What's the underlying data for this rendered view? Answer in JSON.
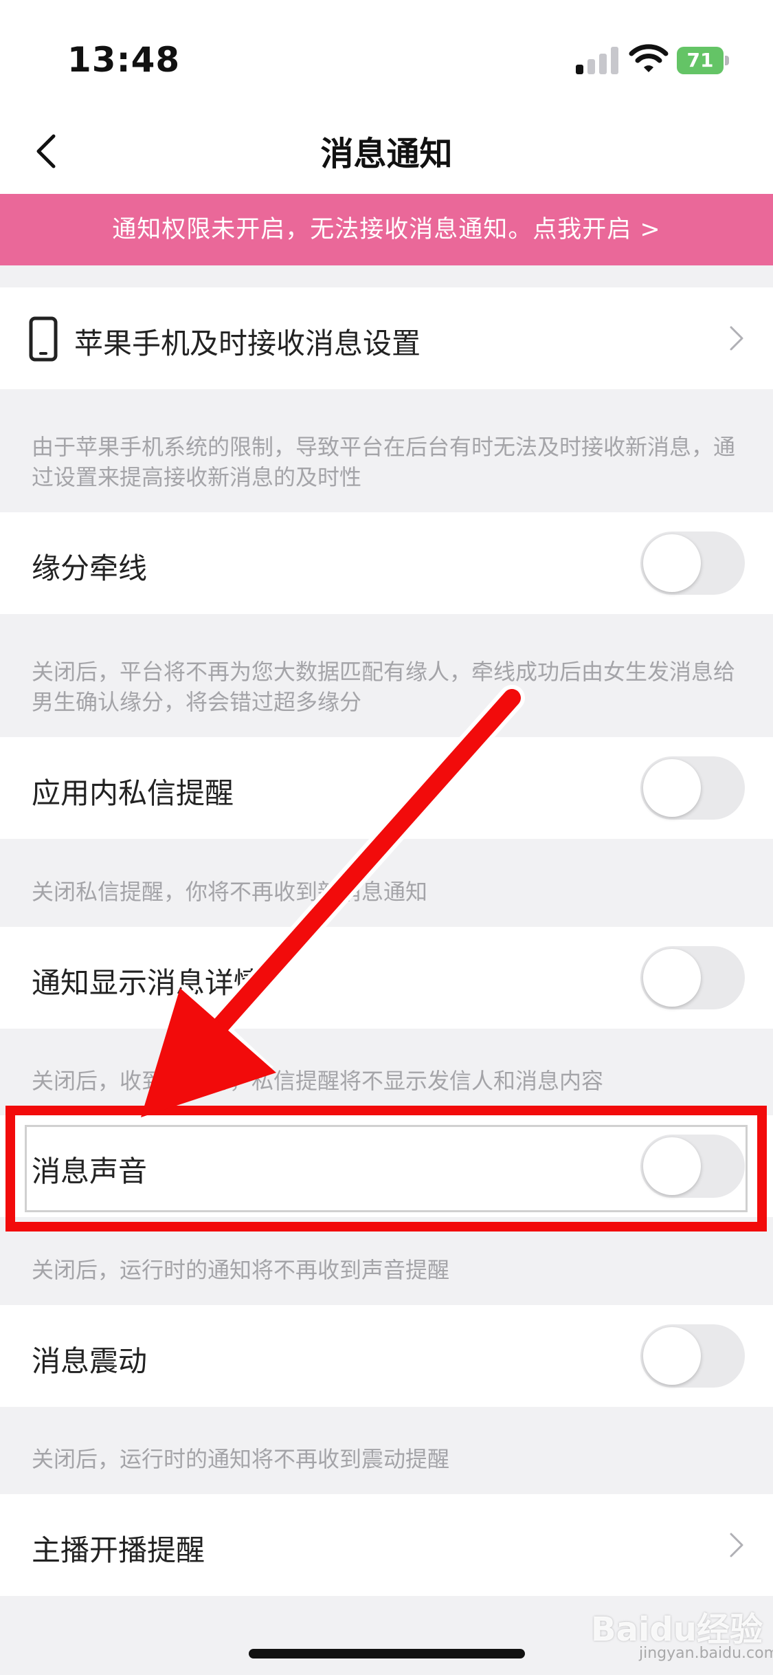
{
  "status_bar": {
    "time": "13:48",
    "battery": "71"
  },
  "nav": {
    "title": "消息通知"
  },
  "banner": {
    "text": "通知权限未开启，无法接收消息通知。点我开启 >"
  },
  "iphone_setting": {
    "label": "苹果手机及时接收消息设置",
    "note": "由于苹果手机系统的限制，导致平台在后台有时无法及时接收新消息，通过设置来提高接收新消息的及时性"
  },
  "settings": [
    {
      "label": "缘分牵线",
      "on": false,
      "note": "关闭后，平台将不再为您大数据匹配有缘人，牵线成功后由女生发消息给男生确认缘分，将会错过超多缘分"
    },
    {
      "label": "应用内私信提醒",
      "on": false,
      "note": "关闭私信提醒，你将不再收到新消息通知"
    },
    {
      "label": "通知显示消息详情",
      "on": false,
      "note": "关闭后，收到消息时，私信提醒将不显示发信人和消息内容"
    },
    {
      "label": "消息声音",
      "on": false,
      "note": "关闭后，运行时的通知将不再收到声音提醒"
    },
    {
      "label": "消息震动",
      "on": false,
      "note": "关闭后，运行时的通知将不再收到震动提醒"
    }
  ],
  "anchor_reminder": {
    "label": "主播开播提醒"
  },
  "watermark": {
    "text": "Baidu经验",
    "sub": "jingyan.baidu.com"
  },
  "colors": {
    "banner": "#ea6899",
    "annotation": "#f20b0b",
    "toggle_off": "#e9e9eb"
  }
}
